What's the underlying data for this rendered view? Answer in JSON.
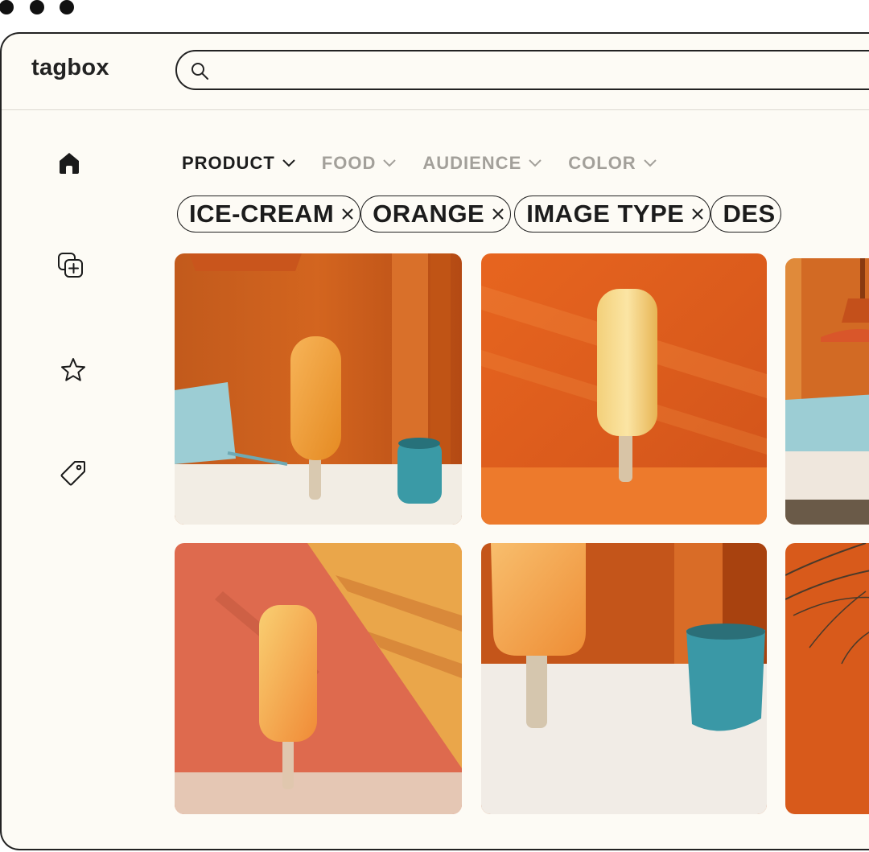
{
  "app": {
    "logo": "tagbox"
  },
  "search": {
    "value": "",
    "placeholder": ""
  },
  "sidebar": {
    "items": [
      {
        "name": "home",
        "icon": "home-icon",
        "active": true
      },
      {
        "name": "add-collection",
        "icon": "add-collection-icon",
        "active": false
      },
      {
        "name": "favorites",
        "icon": "star-icon",
        "active": false
      },
      {
        "name": "tags",
        "icon": "tag-icon",
        "active": false
      }
    ]
  },
  "filters": [
    {
      "label": "PRODUCT",
      "active": true
    },
    {
      "label": "FOOD",
      "active": false
    },
    {
      "label": "AUDIENCE",
      "active": false
    },
    {
      "label": "COLOR",
      "active": false
    }
  ],
  "chips": [
    {
      "label": "ICE-CREAM"
    },
    {
      "label": "ORANGE"
    },
    {
      "label": "IMAGE TYPE"
    },
    {
      "label": "DES"
    }
  ],
  "colors": {
    "background": "#fdfbf5",
    "text": "#1c1c1c",
    "inactive_filter": "#a3a09a",
    "orange": "#e8692a",
    "teal": "#3a9aa6",
    "cream": "#f2ede4"
  },
  "images": [
    {
      "name": "popsicle-chair-cup-lamp"
    },
    {
      "name": "popsicle-orange-shadow"
    },
    {
      "name": "lamp-chair-partial"
    },
    {
      "name": "popsicle-diagonal-wall"
    },
    {
      "name": "popsicle-closeup-cup"
    },
    {
      "name": "plant-orange-partial"
    }
  ]
}
